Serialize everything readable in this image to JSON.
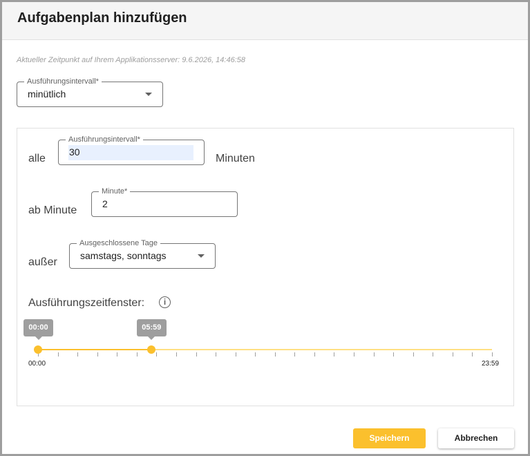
{
  "dialog": {
    "title": "Aufgabenplan hinzufügen",
    "server_time_text": "Aktueller Zeitpunkt auf Ihrem Applikationsserver: 9.6.2026, 14:46:58"
  },
  "interval_select": {
    "label": "Ausführungsintervall*",
    "value": "minütlich"
  },
  "schedule": {
    "every_prefix": "alle",
    "every_field_label": "Ausführungsintervall*",
    "every_value": "30",
    "every_suffix": "Minuten",
    "from_prefix": "ab Minute",
    "minute_field_label": "Minute*",
    "minute_value": "2",
    "except_prefix": "außer",
    "excluded_days_label": "Ausgeschlossene Tage",
    "excluded_days_value": "samstags, sonntags"
  },
  "time_window": {
    "label": "Ausführungszeitfenster:",
    "info_glyph": "i",
    "start_value": "00:00",
    "end_value": "05:59",
    "range_min": "00:00",
    "range_max": "23:59",
    "start_fraction": 0,
    "end_fraction": 0.2493,
    "accent_color": "#fbc02d"
  },
  "buttons": {
    "save_label": "Speichern",
    "cancel_label": "Abbrechen"
  }
}
